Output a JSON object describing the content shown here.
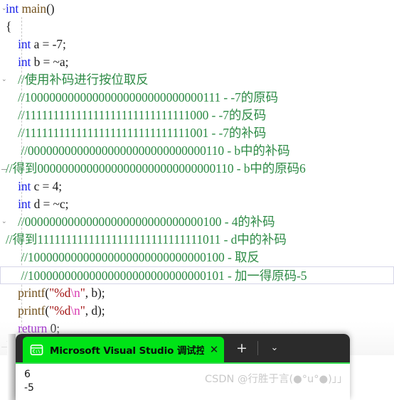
{
  "editor": {
    "lines": [
      {
        "indent": 0,
        "fold": "expanded",
        "tokens": [
          {
            "t": "int",
            "c": "kw"
          },
          {
            "t": " ",
            "c": "plain"
          },
          {
            "t": "main",
            "c": "fn"
          },
          {
            "t": "()",
            "c": "plain"
          }
        ]
      },
      {
        "indent": 0,
        "fold": "none",
        "tokens": [
          {
            "t": "{",
            "c": "plain"
          }
        ]
      },
      {
        "indent": 0,
        "fold": "none",
        "tokens": [
          {
            "t": "    ",
            "c": "plain"
          },
          {
            "t": "int",
            "c": "kw"
          },
          {
            "t": " a = ",
            "c": "plain"
          },
          {
            "t": "-7",
            "c": "num"
          },
          {
            "t": ";",
            "c": "plain"
          }
        ]
      },
      {
        "indent": 0,
        "fold": "none",
        "tokens": [
          {
            "t": "    ",
            "c": "plain"
          },
          {
            "t": "int",
            "c": "kw"
          },
          {
            "t": " b = ~a;",
            "c": "plain"
          }
        ]
      },
      {
        "indent": 0,
        "fold": "expanded",
        "tokens": [
          {
            "t": "    //使用补码进行按位取反",
            "c": "cmt"
          }
        ]
      },
      {
        "indent": 0,
        "fold": "none",
        "tokens": [
          {
            "t": "    //10000000000000000000000000000111 - -7的原码",
            "c": "cmt"
          }
        ]
      },
      {
        "indent": 0,
        "fold": "none",
        "tokens": [
          {
            "t": "    //11111111111111111111111111111000 - -7的反码",
            "c": "cmt"
          }
        ]
      },
      {
        "indent": 0,
        "fold": "none",
        "tokens": [
          {
            "t": "    //11111111111111111111111111111001 - -7的补码",
            "c": "cmt"
          }
        ]
      },
      {
        "indent": 0,
        "fold": "none",
        "tokens": [
          {
            "t": "     //00000000000000000000000000000110 - b中的补码",
            "c": "cmt"
          }
        ]
      },
      {
        "indent": 0,
        "fold": "minus",
        "tokens": [
          {
            "t": "//得到00000000000000000000000000000110 - b中的原码6",
            "c": "cmt"
          }
        ]
      },
      {
        "indent": 0,
        "fold": "none",
        "tokens": [
          {
            "t": "    ",
            "c": "plain"
          },
          {
            "t": "int",
            "c": "kw"
          },
          {
            "t": " c = ",
            "c": "plain"
          },
          {
            "t": "4",
            "c": "num"
          },
          {
            "t": ";",
            "c": "plain"
          }
        ]
      },
      {
        "indent": 0,
        "fold": "none",
        "tokens": [
          {
            "t": "    ",
            "c": "plain"
          },
          {
            "t": "int",
            "c": "kw"
          },
          {
            "t": " d = ~c;",
            "c": "plain"
          }
        ]
      },
      {
        "indent": 0,
        "fold": "expanded",
        "tokens": [
          {
            "t": "    //00000000000000000000000000000100 - 4的补码",
            "c": "cmt"
          }
        ]
      },
      {
        "indent": 0,
        "fold": "none",
        "tokens": [
          {
            "t": "//得到11111111111111111111111111111011 - d中的补码",
            "c": "cmt"
          }
        ]
      },
      {
        "indent": 0,
        "fold": "none",
        "tokens": [
          {
            "t": "     //10000000000000000000000000000100 - 取反",
            "c": "cmt"
          }
        ]
      },
      {
        "indent": 0,
        "fold": "none",
        "current": true,
        "tokens": [
          {
            "t": "     //10000000000000000000000000000101 - 加一得原码-5",
            "c": "cmt"
          }
        ]
      },
      {
        "indent": 0,
        "fold": "none",
        "tokens": [
          {
            "t": "    ",
            "c": "plain"
          },
          {
            "t": "printf",
            "c": "fn"
          },
          {
            "t": "(",
            "c": "plain"
          },
          {
            "t": "\"%d",
            "c": "str"
          },
          {
            "t": "\\n",
            "c": "esc"
          },
          {
            "t": "\"",
            "c": "str"
          },
          {
            "t": ", b);",
            "c": "plain"
          }
        ]
      },
      {
        "indent": 0,
        "fold": "none",
        "tokens": [
          {
            "t": "    ",
            "c": "plain"
          },
          {
            "t": "printf",
            "c": "fn"
          },
          {
            "t": "(",
            "c": "plain"
          },
          {
            "t": "\"%d",
            "c": "str"
          },
          {
            "t": "\\n",
            "c": "esc"
          },
          {
            "t": "\"",
            "c": "str"
          },
          {
            "t": ", d);",
            "c": "plain"
          }
        ]
      },
      {
        "indent": 0,
        "fold": "none",
        "tokens": [
          {
            "t": "    ",
            "c": "plain"
          },
          {
            "t": "return",
            "c": "kw2"
          },
          {
            "t": " ",
            "c": "plain"
          },
          {
            "t": "0",
            "c": "num"
          },
          {
            "t": ";",
            "c": "plain"
          }
        ]
      },
      {
        "indent": 0,
        "fold": "minus",
        "tokens": [
          {
            "t": "}",
            "c": "plain"
          }
        ]
      }
    ]
  },
  "terminal": {
    "tab": {
      "icon": "console-window-icon",
      "icon_label": "C:\\",
      "title": "Microsoft Visual Studio 调试控",
      "close_label": "✕"
    },
    "new_tab_label": "+",
    "menu_label": "⌄",
    "output": [
      "6",
      "-5"
    ]
  },
  "watermark": {
    "text": "CSDN @行胜于言(●°u°●)」」"
  },
  "colors": {
    "keyword": "#1c24e8",
    "keyword_flow": "#8f08c4",
    "function": "#74531f",
    "comment": "#2e8b46",
    "string": "#a31515",
    "escape": "#d838b0",
    "tab_active": "#00e317",
    "tab_bar": "#2b2b2b"
  }
}
